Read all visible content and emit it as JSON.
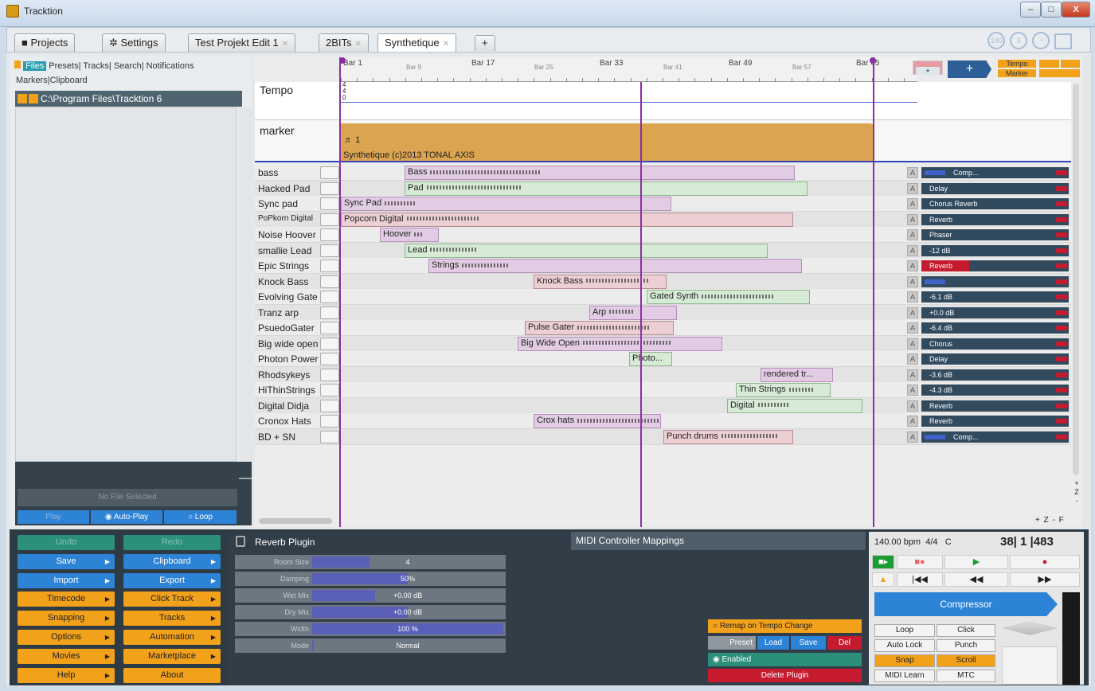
{
  "window": {
    "title": "Tracktion",
    "min": "–",
    "max": "□",
    "close": "X"
  },
  "tabs": [
    {
      "label": "Projects"
    },
    {
      "label": "Settings"
    },
    {
      "label": "Test Projekt Edit 1"
    },
    {
      "label": "2BITs"
    },
    {
      "label": "Synthetique"
    },
    {
      "label": "+"
    }
  ],
  "browser": {
    "nav": [
      "Files",
      "Presets",
      "Tracks",
      "Search",
      "Notifications"
    ],
    "nav2": [
      "Markers",
      "Clipboard"
    ],
    "path": "C:\\Program Files\\Tracktion 6",
    "no_file": "No File Selected",
    "play": "Play",
    "autoplay": "Auto-Play",
    "loop": "Loop"
  },
  "ruler": {
    "bars": [
      "Bar 1",
      "Bar 9",
      "Bar 17",
      "Bar 25",
      "Bar 33",
      "Bar 41",
      "Bar 49",
      "Bar 57",
      "Bar 65"
    ],
    "tempo_btn": "Tempo",
    "marker_btn": "Marker",
    "plus": "+"
  },
  "tempo": {
    "label": "Tempo",
    "sig_top": "4",
    "sig_bot": "4",
    "zero": "0"
  },
  "marker": {
    "label": "marker",
    "num": "1",
    "text": "Synthetique (c)2013 TONAL AXIS"
  },
  "tracks": [
    {
      "name": "bass",
      "clip": "Bass",
      "fx": "Comp...",
      "color": "purple"
    },
    {
      "name": "Hacked Pad",
      "clip": "Pad",
      "fx": "Delay",
      "color": "green"
    },
    {
      "name": "Sync pad",
      "clip": "Sync Pad",
      "fx": "Chorus Reverb",
      "color": "purple"
    },
    {
      "name": "PoPkorn Digital",
      "clip": "Popcorn Digital",
      "fx": "Reverb",
      "color": "pink"
    },
    {
      "name": "Noise Hoover",
      "clip": "Hoover",
      "fx": "Phaser",
      "color": "purple"
    },
    {
      "name": "smallie Lead",
      "clip": "Lead",
      "fx": "-12 dB",
      "color": "green"
    },
    {
      "name": "Epic Strings",
      "clip": "Strings",
      "fx": "Reverb",
      "color": "purple"
    },
    {
      "name": "Knock Bass",
      "clip": "Knock Bass",
      "fx": "",
      "color": "pink"
    },
    {
      "name": "Evolving Gate",
      "clip": "Gated Synth",
      "fx": "-6.1 dB",
      "color": "green"
    },
    {
      "name": "Tranz arp",
      "clip": "Arp",
      "fx": "+0.0 dB",
      "color": "purple"
    },
    {
      "name": "PsuedoGater",
      "clip": "Pulse Gater",
      "fx": "-6.4 dB",
      "color": "pink"
    },
    {
      "name": "Big wide open",
      "clip": "Big Wide Open",
      "fx": "Chorus",
      "color": "purple"
    },
    {
      "name": "Photon Power",
      "clip": "Photo...",
      "fx": "Delay",
      "color": "green"
    },
    {
      "name": "Rhodsykeys",
      "clip": "rendered tr...",
      "fx": "-3.6 dB",
      "color": "purple"
    },
    {
      "name": "HiThinStrings",
      "clip": "Thin Strings",
      "fx": "-4.3 dB",
      "color": "green"
    },
    {
      "name": "Digital Didja",
      "clip": "Digital",
      "fx": "Reverb",
      "color": "green"
    },
    {
      "name": "Cronox Hats",
      "clip": "Crox hats",
      "fx": "Reverb",
      "color": "purple"
    },
    {
      "name": "BD + SN",
      "clip": "Punch drums",
      "fx": "Comp...",
      "color": "pink"
    }
  ],
  "zoom": {
    "plus": "+",
    "z": "Z",
    "minus": "-",
    "footer": "+ Z - F"
  },
  "leftbuttons": {
    "undo": "Undo",
    "redo": "Redo",
    "save": "Save",
    "clipboard": "Clipboard",
    "import": "Import",
    "export": "Export",
    "timecode": "Timecode",
    "clicktrack": "Click Track",
    "snapping": "Snapping",
    "tracks": "Tracks",
    "options": "Options",
    "automation": "Automation",
    "movies": "Movies",
    "marketplace": "Marketplace",
    "help": "Help",
    "about": "About"
  },
  "plugin": {
    "title": "Reverb Plugin",
    "params": [
      {
        "label": "Room Size",
        "value": "4",
        "level": 0.3
      },
      {
        "label": "Damping",
        "value": "50%",
        "level": 0.5
      },
      {
        "label": "Wet Mix",
        "value": "+0.00 dB",
        "level": 0.33
      },
      {
        "label": "Dry Mix",
        "value": "+0.00 dB",
        "level": 0.5
      },
      {
        "label": "Width",
        "value": "100 %",
        "level": 1.0
      },
      {
        "label": "Mode",
        "value": "Normal",
        "level": 0.0
      }
    ]
  },
  "midi": {
    "title": "MIDI Controller Mappings",
    "remap": "Remap on Tempo Change",
    "preset": "Preset",
    "load": "Load",
    "save": "Save",
    "del": "Del",
    "enabled": "Enabled",
    "delete": "Delete Plugin"
  },
  "transport": {
    "bpm": "140.00 bpm",
    "sig": "4/4",
    "key": "C",
    "position": "38| 1 |483",
    "compressor": "Compressor",
    "loop": "Loop",
    "click": "Click",
    "autolock": "Auto Lock",
    "punch": "Punch",
    "snap": "Snap",
    "scroll": "Scroll",
    "midilearn": "MIDI Learn",
    "mtc": "MTC"
  },
  "colors": {
    "accent_blue": "#2d83d6",
    "orange": "#f2a11a",
    "marker": "#dba451",
    "purple_line": "#8b2fa2",
    "red": "#c61b2e"
  }
}
